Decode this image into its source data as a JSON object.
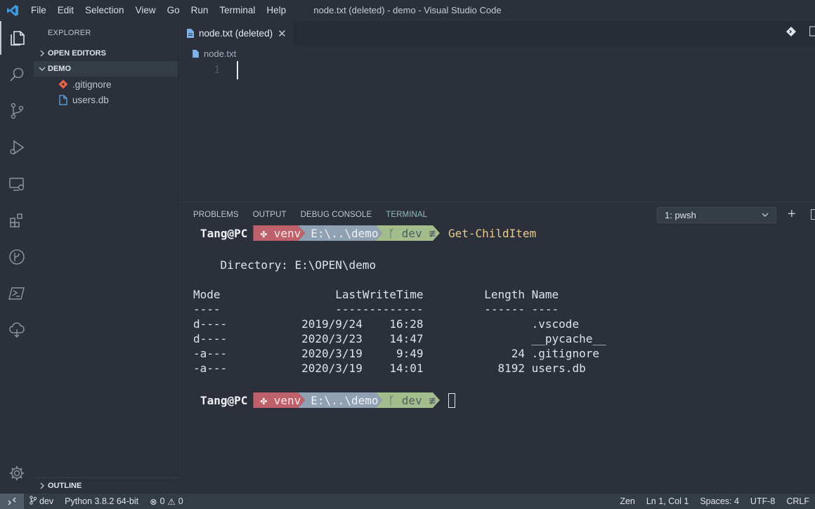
{
  "window": {
    "title": "node.txt (deleted) - demo - Visual Studio Code"
  },
  "menu": [
    "File",
    "Edit",
    "Selection",
    "View",
    "Go",
    "Run",
    "Terminal",
    "Help"
  ],
  "sidebar": {
    "title": "EXPLORER",
    "sections": {
      "open_editors": "OPEN EDITORS",
      "folder": "DEMO",
      "outline": "OUTLINE"
    },
    "files": [
      {
        "name": ".gitignore",
        "icon": "git-icon",
        "color": "#e8624a"
      },
      {
        "name": "users.db",
        "icon": "file-icon",
        "color": "#5fa8e8"
      }
    ]
  },
  "editor": {
    "tab_label": "node.txt (deleted)",
    "breadcrumb": "node.txt",
    "line_number": "1"
  },
  "panel": {
    "tabs": [
      "PROBLEMS",
      "OUTPUT",
      "DEBUG CONSOLE",
      "TERMINAL"
    ],
    "active_tab": "TERMINAL",
    "terminal_select": "1: pwsh"
  },
  "terminal": {
    "prompt": {
      "user": "Tang@PC",
      "venv": "venv",
      "path": "E:\\..\\demo",
      "branch": "dev ≢"
    },
    "command": "Get-ChildItem",
    "directory_line": "    Directory: E:\\OPEN\\demo",
    "header": "Mode                 LastWriteTime         Length Name",
    "underline": "----                 -------------         ------ ----",
    "rows": [
      "d----           2019/9/24    16:28                .vscode",
      "d----           2020/3/23    14:47                __pycache__",
      "-a---           2020/3/19     9:49             24 .gitignore",
      "-a---           2020/3/19    14:01           8192 users.db"
    ]
  },
  "statusbar": {
    "branch": "dev",
    "python": "Python 3.8.2 64-bit",
    "errors": "0",
    "warnings": "0",
    "zen": "Zen",
    "position": "Ln 1, Col 1",
    "spaces": "Spaces: 4",
    "encoding": "UTF-8",
    "eol": "CRLF"
  },
  "colors": {
    "background": "#2b303b",
    "accent_blue": "#3c99dc",
    "venv": "#bf616a",
    "path": "#8fa1b3",
    "git": "#a3be8c",
    "command": "#ebcb8b"
  }
}
